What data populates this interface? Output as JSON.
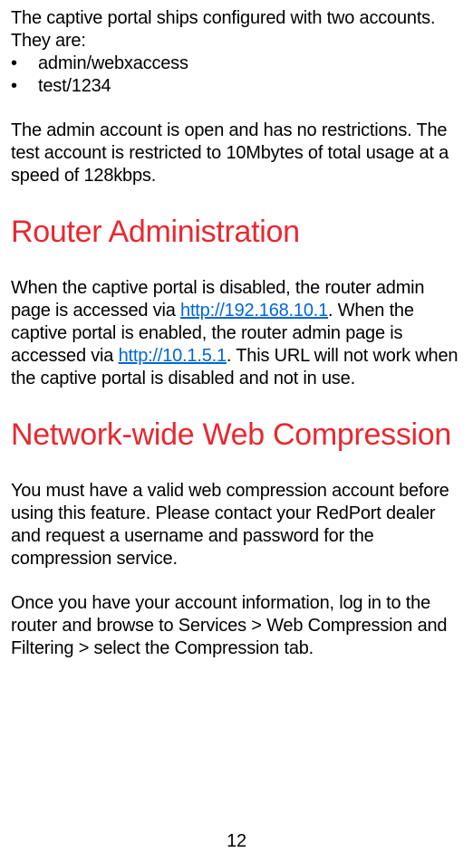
{
  "intro": {
    "text_lead": "The captive portal ships configured with two accounts. They are:",
    "bullets": [
      "admin/webxaccess",
      "test/1234"
    ],
    "text_after": "The admin account is open and has no restrictions. The test account is restricted to 10Mbytes of total usage at a speed of 128kbps."
  },
  "router_admin": {
    "heading": "Router Administration",
    "para_pre_link1": "When the captive portal is disabled, the router admin page is accessed via ",
    "link1_text": "http://192.168.10.1",
    "para_mid": ".  When the captive portal is enabled, the router admin page is accessed via ",
    "link2_text": "http://10.1.5.1",
    "para_post": ".  This URL will not work when the captive portal is disabled and not in use."
  },
  "compression": {
    "heading": "Network-wide Web Compression",
    "para1": "You must have a valid web compression account before using this feature. Please contact your RedPort dealer and request a username and password for the compression service.",
    "para2": "Once you have your account information, log in to the router and browse to Services > Web Compression and Filtering > select the Compression tab."
  },
  "page_number": "12"
}
